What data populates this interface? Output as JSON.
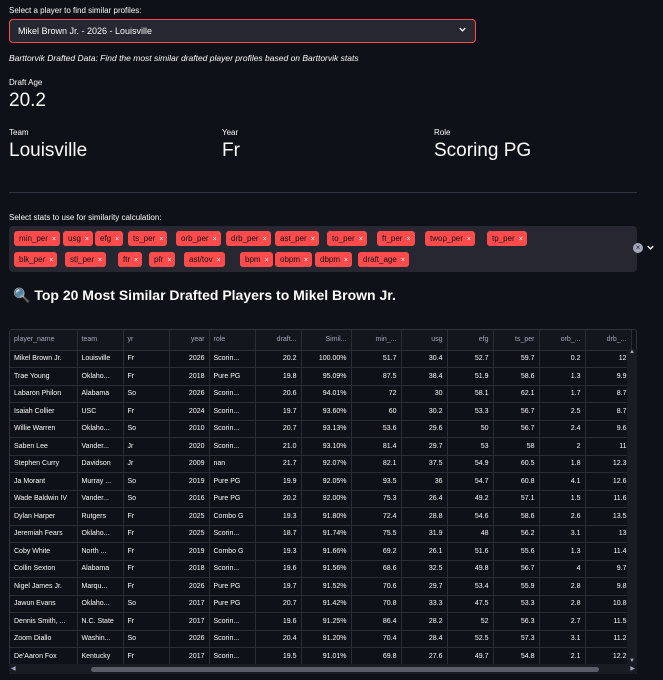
{
  "select": {
    "label": "Select a player to find similar profiles:",
    "value": "Mikel Brown Jr. - 2026 - Louisville"
  },
  "caption": "Barttorvik Drafted Data: Find the most similar drafted player profiles based on Barttorvik stats",
  "metrics": {
    "draft_age": {
      "label": "Draft Age",
      "value": "20.2"
    },
    "team": {
      "label": "Team",
      "value": "Louisville"
    },
    "year": {
      "label": "Year",
      "value": "Fr"
    },
    "role": {
      "label": "Role",
      "value": "Scoring PG"
    }
  },
  "stats_select": {
    "label": "Select stats to use for similarity calculation:",
    "tags_row1": [
      "min_per",
      "usg",
      "efg",
      "ts_per",
      "orb_per",
      "drb_per",
      "ast_per",
      "to_per",
      "ft_per",
      "twop_per",
      "tp_per"
    ],
    "tags_row2": [
      "blk_per",
      "stl_per",
      "ftr",
      "pfr",
      "ast/tov",
      "bpm",
      "obpm",
      "dbpm",
      "draft_age"
    ],
    "remove_glyph": "×"
  },
  "results": {
    "icon": "🔍",
    "title": "Top 20 Most Similar Drafted Players to Mikel Brown Jr."
  },
  "table": {
    "columns": [
      "player_name",
      "team",
      "yr",
      "year",
      "role",
      "draft...",
      "Simil...",
      "min_...",
      "usg",
      "efg",
      "ts_per",
      "orb_...",
      "drb_..."
    ],
    "rows": [
      [
        "Mikel Brown Jr.",
        "Louisville",
        "Fr",
        "2026",
        "Scorin...",
        "20.2",
        "100.00%",
        "51.7",
        "30.4",
        "52.7",
        "59.7",
        "0.2",
        "12"
      ],
      [
        "Trae Young",
        "Oklaho...",
        "Fr",
        "2018",
        "Pure PG",
        "19.8",
        "95.09%",
        "87.5",
        "38.4",
        "51.9",
        "58.6",
        "1.3",
        "9.9"
      ],
      [
        "Labaron Philon",
        "Alabama",
        "So",
        "2026",
        "Scorin...",
        "20.6",
        "94.01%",
        "72",
        "30",
        "58.1",
        "62.1",
        "1.7",
        "8.7"
      ],
      [
        "Isaiah Collier",
        "USC",
        "Fr",
        "2024",
        "Scorin...",
        "19.7",
        "93.60%",
        "60",
        "30.2",
        "53.3",
        "56.7",
        "2.5",
        "8.7"
      ],
      [
        "Willie Warren",
        "Oklaho...",
        "So",
        "2010",
        "Scorin...",
        "20.7",
        "93.13%",
        "53.6",
        "29.6",
        "50",
        "56.7",
        "2.4",
        "9.6"
      ],
      [
        "Saben Lee",
        "Vander...",
        "Jr",
        "2020",
        "Scorin...",
        "21.0",
        "93.10%",
        "81.4",
        "29.7",
        "53",
        "58",
        "2",
        "11"
      ],
      [
        "Stephen Curry",
        "Davidson",
        "Jr",
        "2009",
        "nan",
        "21.7",
        "92.07%",
        "82.1",
        "37.5",
        "54.9",
        "60.5",
        "1.8",
        "12.3"
      ],
      [
        "Ja Morant",
        "Murray ...",
        "So",
        "2019",
        "Pure PG",
        "19.9",
        "92.05%",
        "93.5",
        "36",
        "54.7",
        "60.8",
        "4.1",
        "12.6"
      ],
      [
        "Wade Baldwin IV",
        "Vander...",
        "So",
        "2016",
        "Pure PG",
        "20.2",
        "92.00%",
        "75.3",
        "26.4",
        "49.2",
        "57.1",
        "1.5",
        "11.6"
      ],
      [
        "Dylan Harper",
        "Rutgers",
        "Fr",
        "2025",
        "Combo G",
        "19.3",
        "91.80%",
        "72.4",
        "28.8",
        "54.6",
        "58.6",
        "2.6",
        "13.5"
      ],
      [
        "Jeremiah Fears",
        "Oklaho...",
        "Fr",
        "2025",
        "Scorin...",
        "18.7",
        "91.74%",
        "75.5",
        "31.9",
        "48",
        "56.2",
        "3.1",
        "13"
      ],
      [
        "Coby White",
        "North ...",
        "Fr",
        "2019",
        "Combo G",
        "19.3",
        "91.66%",
        "69.2",
        "26.1",
        "51.6",
        "55.6",
        "1.3",
        "11.4"
      ],
      [
        "Collin Sexton",
        "Alabama",
        "Fr",
        "2018",
        "Scorin...",
        "19.6",
        "91.56%",
        "68.6",
        "32.5",
        "49.8",
        "56.7",
        "4",
        "9.7"
      ],
      [
        "Nigel James Jr.",
        "Marqu...",
        "Fr",
        "2026",
        "Pure PG",
        "19.7",
        "91.52%",
        "70.6",
        "29.7",
        "53.4",
        "55.9",
        "2.8",
        "9.8"
      ],
      [
        "Jawun Evans",
        "Oklaho...",
        "So",
        "2017",
        "Pure PG",
        "20.7",
        "91.42%",
        "70.8",
        "33.3",
        "47.5",
        "53.3",
        "2.8",
        "10.8"
      ],
      [
        "Dennis Smith, ...",
        "N.C. State",
        "Fr",
        "2017",
        "Scorin...",
        "19.6",
        "91.25%",
        "86.4",
        "28.2",
        "52",
        "56.3",
        "2.7",
        "11.5"
      ],
      [
        "Zoom Diallo",
        "Washin...",
        "So",
        "2026",
        "Scorin...",
        "20.4",
        "91.20%",
        "70.4",
        "28.4",
        "52.5",
        "57.3",
        "3.1",
        "11.2"
      ],
      [
        "De'Aaron Fox",
        "Kentucky",
        "Fr",
        "2017",
        "Scorin...",
        "19.5",
        "91.01%",
        "69.8",
        "27.6",
        "49.7",
        "54.8",
        "2.1",
        "12.2"
      ],
      [
        "John Wall",
        "Kentucky",
        "Fr",
        "2010",
        "Pure PG",
        "19.7",
        "90.85%",
        "83.9",
        "26.9",
        "50.3",
        "56.2",
        "2.7",
        "10.1"
      ],
      [
        "Nick Calathes",
        "Florida",
        "So",
        "2009",
        "nan",
        "20.7",
        "90.39%",
        "83.3",
        "27.8",
        "56.8",
        "59.9",
        "3",
        "15.7"
      ]
    ]
  }
}
